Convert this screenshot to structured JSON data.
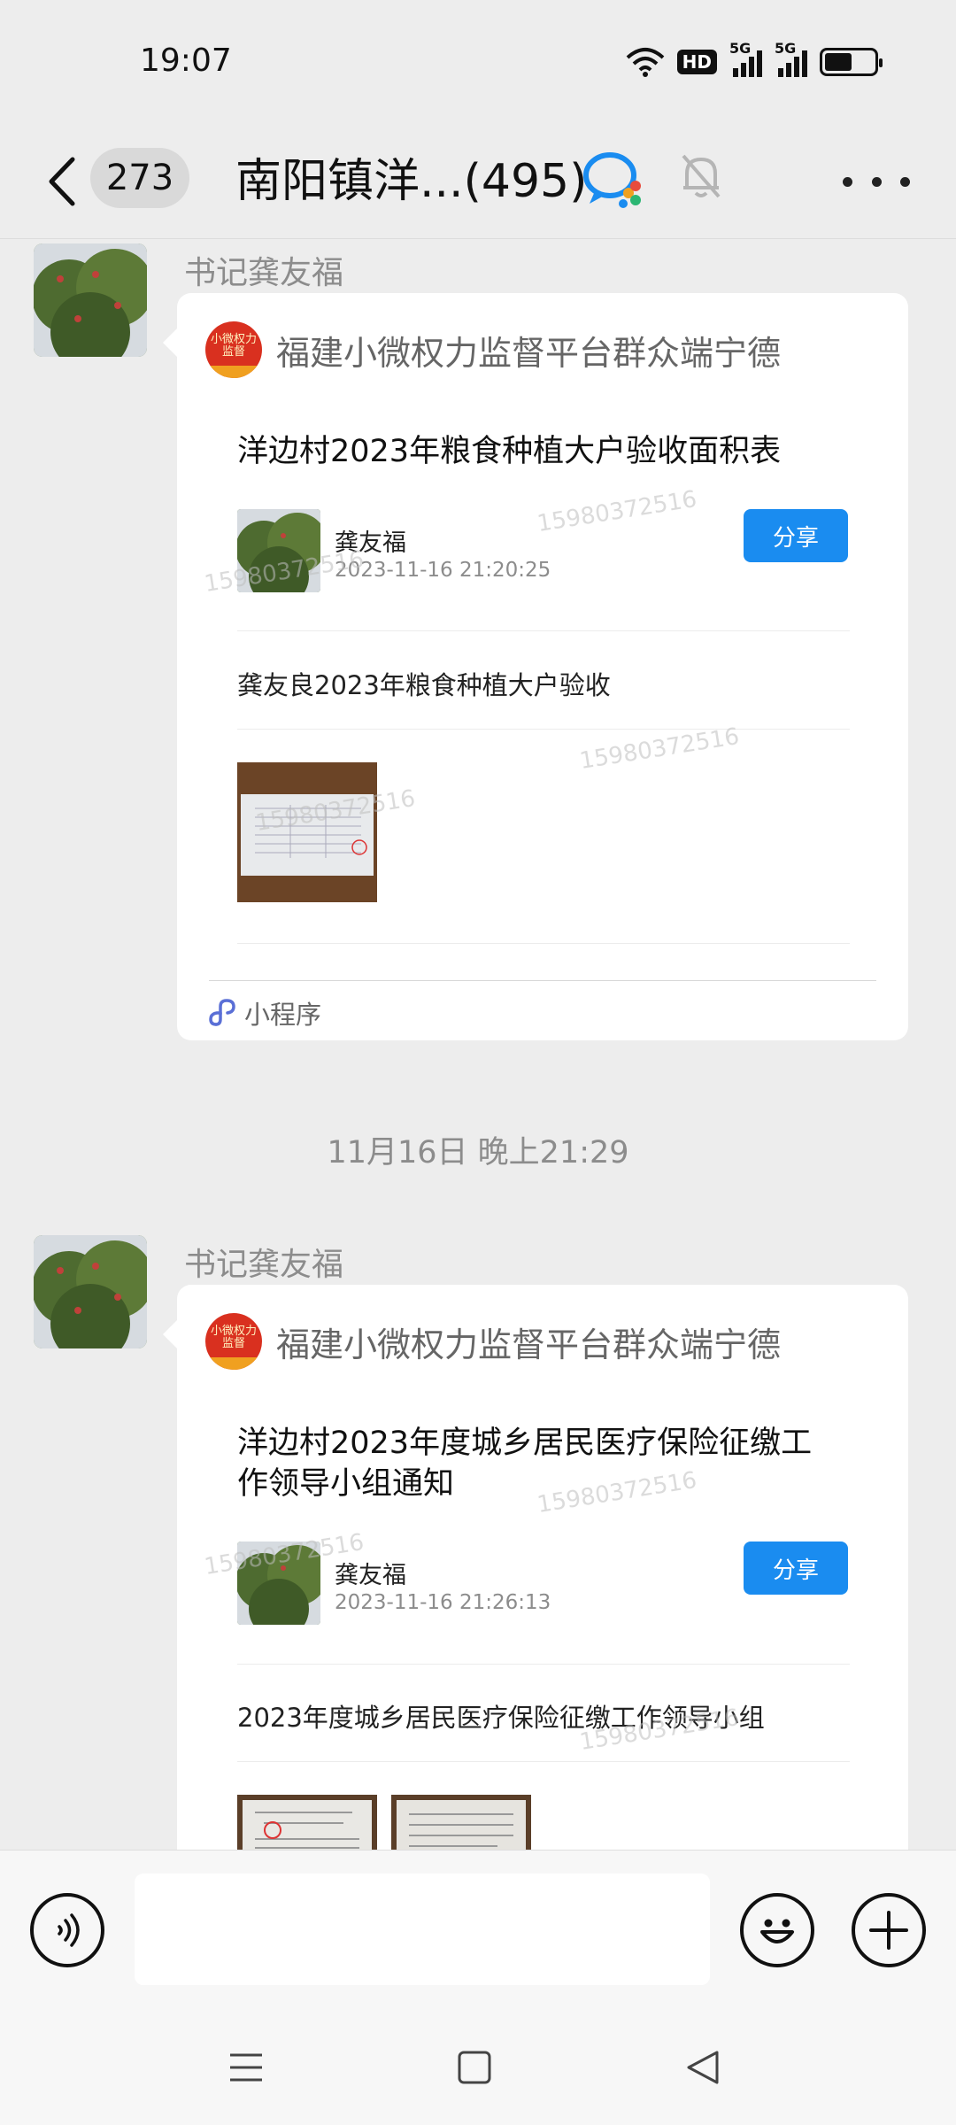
{
  "status_bar": {
    "time": "19:07",
    "hd_label": "HD",
    "sim1_label": "5G",
    "sim2_label": "5G",
    "battery_level": 0.55
  },
  "nav": {
    "unread_count": "273",
    "title": "南阳镇洋...(495)"
  },
  "messages": [
    {
      "sender": "书记龚友福",
      "app_name": "福建小微权力监督平台群众端宁德",
      "app_logo_text": "小微权力监督",
      "title": "洋边村2023年粮食种植大户验收面积表",
      "author": "龚友福",
      "timestamp": "2023-11-16 21:20:25",
      "share_label": "分享",
      "description": "龚友良2023年粮食种植大户验收",
      "footer_label": "小程序"
    },
    {
      "sender": "书记龚友福",
      "app_name": "福建小微权力监督平台群众端宁德",
      "app_logo_text": "小微权力监督",
      "title": "洋边村2023年度城乡居民医疗保险征缴工作领导小组通知",
      "author": "龚友福",
      "timestamp": "2023-11-16 21:26:13",
      "share_label": "分享",
      "description": "2023年度城乡居民医疗保险征缴工作领导小组"
    }
  ],
  "time_separator": "11月16日 晚上21:29",
  "watermark": "15980372516",
  "icons": {
    "back": "chevron-left-icon",
    "work": "wecom-chat-icon",
    "mute": "bell-off-icon",
    "more": "more-dots-icon",
    "voice": "voice-icon",
    "emoji": "emoji-icon",
    "plus": "plus-icon",
    "mini_program": "mini-program-icon"
  },
  "colors": {
    "share_button": "#1a8cf0",
    "background": "#ededed",
    "app_logo": "#d9301f"
  }
}
